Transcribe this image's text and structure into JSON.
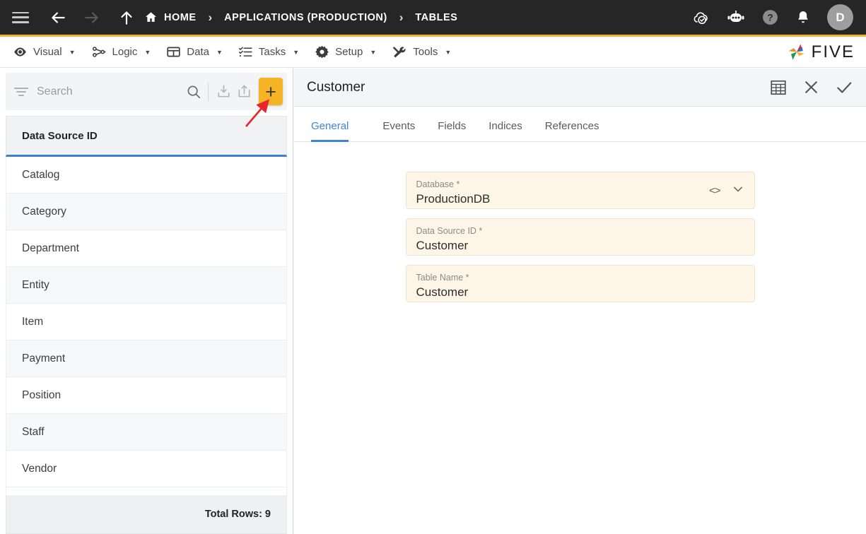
{
  "topbar": {
    "menu_icon": "hamburger-icon",
    "back_icon": "arrow-left-icon",
    "forward_icon": "arrow-right-icon",
    "up_icon": "arrow-up-icon",
    "breadcrumb": [
      {
        "label": "HOME",
        "icon": "home-icon"
      },
      {
        "label": "APPLICATIONS (PRODUCTION)",
        "icon": ""
      },
      {
        "label": "TABLES",
        "icon": ""
      }
    ],
    "separator": "›",
    "right_icons": [
      "cloud-check-icon",
      "robot-icon",
      "help-icon",
      "bell-icon"
    ],
    "avatar_initial": "D"
  },
  "menubar": {
    "items": [
      {
        "label": "Visual",
        "icon": "eye-icon"
      },
      {
        "label": "Logic",
        "icon": "logic-nodes-icon"
      },
      {
        "label": "Data",
        "icon": "table-grid-icon"
      },
      {
        "label": "Tasks",
        "icon": "checklist-icon"
      },
      {
        "label": "Setup",
        "icon": "gear-icon"
      },
      {
        "label": "Tools",
        "icon": "tools-icon"
      }
    ],
    "caret": "▼",
    "logo_text": "FIVE"
  },
  "sidebar": {
    "search_placeholder": "Search",
    "search_value": "",
    "toolbar_icons": [
      "filter-icon",
      "search-icon",
      "import-icon",
      "export-icon",
      "add-icon"
    ],
    "add_button_color": "#F5B325",
    "column_header": "Data Source ID",
    "rows": [
      "Catalog",
      "Category",
      "Department",
      "Entity",
      "Item",
      "Payment",
      "Position",
      "Staff",
      "Vendor"
    ],
    "total_rows_label": "Total Rows: 9"
  },
  "detail": {
    "title": "Customer",
    "header_icons": [
      "table-view-icon",
      "close-icon",
      "confirm-icon"
    ],
    "tabs": [
      {
        "label": "General",
        "active": true
      },
      {
        "label": "Events",
        "active": false
      },
      {
        "label": "Fields",
        "active": false
      },
      {
        "label": "Indices",
        "active": false
      },
      {
        "label": "References",
        "active": false
      }
    ],
    "active_tab_color": "#3f83de",
    "fields": [
      {
        "label": "Database *",
        "value": "ProductionDB",
        "icons": [
          "code-icon",
          "chevron-down-icon"
        ]
      },
      {
        "label": "Data Source ID *",
        "value": "Customer",
        "icons": []
      },
      {
        "label": "Table Name *",
        "value": "Customer",
        "icons": []
      }
    ],
    "field_background": "#FDF5E6"
  },
  "annotation": {
    "arrow_color": "#e8252a",
    "points_to": "add-button"
  }
}
